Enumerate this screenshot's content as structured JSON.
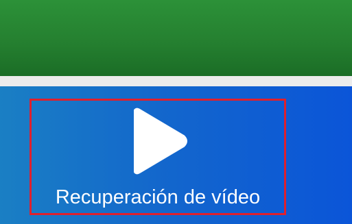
{
  "feature": {
    "label": "Recuperación de vídeo",
    "icon": "play-icon"
  },
  "colors": {
    "banner_green": "#258030",
    "panel_blue": "#1367cc",
    "highlight_red": "#e0202c",
    "icon_white": "#ffffff"
  }
}
